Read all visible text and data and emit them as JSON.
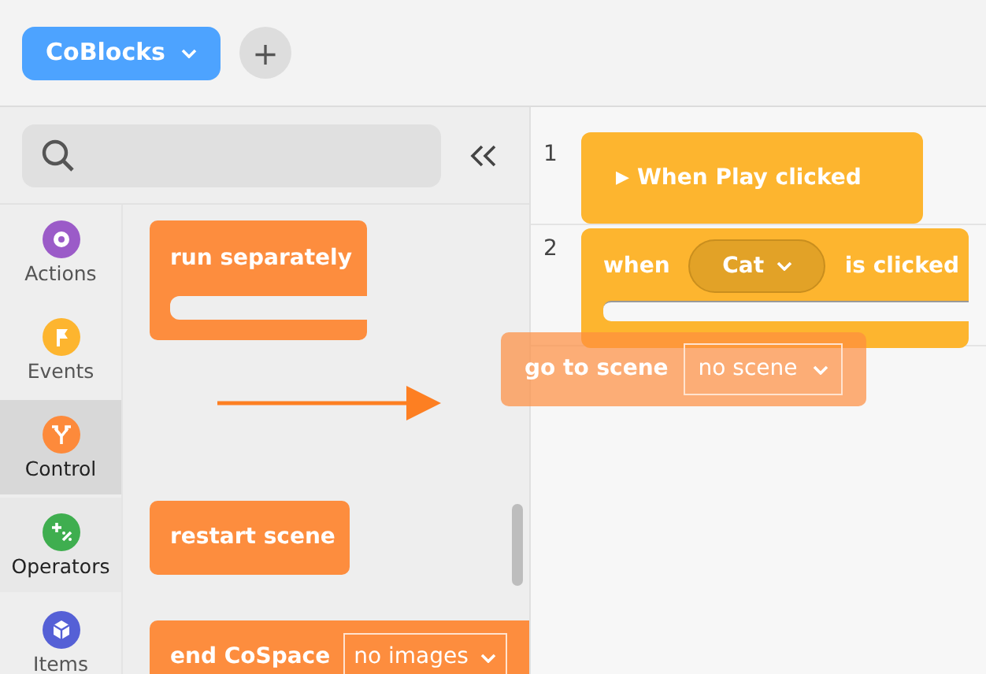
{
  "toolbar": {
    "project_button": {
      "label": "CoBlocks"
    },
    "add_button": {
      "label": "+"
    }
  },
  "categories": [
    {
      "label": "Actions",
      "color": "#9b5bc8",
      "selected": false,
      "highlighted": false
    },
    {
      "label": "Events",
      "color": "#fdb52f",
      "selected": false,
      "highlighted": false
    },
    {
      "label": "Control",
      "color": "#fd8a3b",
      "selected": true,
      "highlighted": true
    },
    {
      "label": "Operators",
      "color": "#3fae4f",
      "selected": false,
      "highlighted": true
    },
    {
      "label": "Items",
      "color": "#5560d6",
      "selected": false,
      "highlighted": false
    }
  ],
  "palette_blocks": [
    {
      "kind": "c-block",
      "label": "run separately"
    },
    {
      "kind": "stack",
      "label": "restart scene"
    },
    {
      "kind": "dropdown",
      "label": "end CoSpace",
      "dropdown": "no images"
    }
  ],
  "workspace": {
    "line_numbers": [
      "1",
      "2"
    ],
    "scripts": [
      {
        "kind": "hat",
        "icon": "▶",
        "label": "When Play clicked"
      },
      {
        "kind": "event",
        "prefix": "when",
        "dropdown": "Cat",
        "suffix": "is clicked"
      }
    ]
  },
  "dragged_block": {
    "label": "go to scene",
    "dropdown": "no scene"
  }
}
